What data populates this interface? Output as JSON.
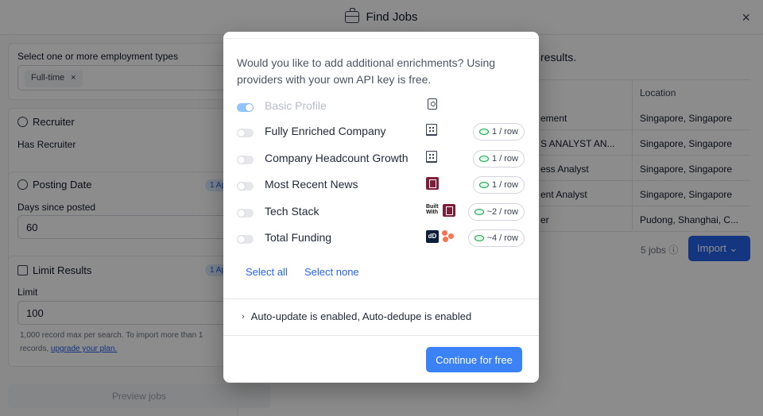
{
  "window": {
    "title": "Find Jobs",
    "close_icon": "×"
  },
  "left_panel": {
    "employment_label": "Select one or more employment types",
    "employment_chip": "Full-time",
    "chip_remove": "×",
    "recruiter_title": "Recruiter",
    "recruiter_option": "Has Recruiter",
    "posting_title": "Posting Date",
    "posting_badge": "1 Ap",
    "days_label": "Days since posted",
    "days_value": "60",
    "limit_title": "Limit Results",
    "limit_badge": "1 Ap",
    "limit_label": "Limit",
    "limit_value": "100",
    "help_text": "1,000 record max per search. To import more than 1",
    "help_text_2": "records, ",
    "upgrade_link": "upgrade your plan.",
    "preview_label": "Preview jobs"
  },
  "results": {
    "heading": "results.",
    "location_header": "Location",
    "rows": [
      {
        "title": "ement",
        "location": "Singapore, Singapore"
      },
      {
        "title": "S ANALYST AN...",
        "location": "Singapore, Singapore"
      },
      {
        "title": "ess Analyst",
        "location": "Singapore, Singapore"
      },
      {
        "title": "ent Analyst",
        "location": "Singapore, Singapore"
      },
      {
        "title": "er",
        "location": "Pudong, Shanghai, C..."
      }
    ],
    "jobs_count": "5 jobs ⓘ",
    "import_label": "Import ⌄"
  },
  "modal": {
    "question": "Would you like to add additional enrichments? Using providers with your own API key is free.",
    "enrichments": [
      {
        "label": "Basic Profile",
        "enabled": true,
        "disabled": true,
        "cost": ""
      },
      {
        "label": "Fully Enriched Company",
        "enabled": false,
        "cost": "1 / row"
      },
      {
        "label": "Company Headcount Growth",
        "enabled": false,
        "cost": "1 / row"
      },
      {
        "label": "Most Recent News",
        "enabled": false,
        "cost": "1 / row"
      },
      {
        "label": "Tech Stack",
        "enabled": false,
        "cost": "~2 / row"
      },
      {
        "label": "Total Funding",
        "enabled": false,
        "cost": "~4 / row"
      }
    ],
    "providers": {
      "builtwith_logo": "Built With",
      "dealroom_logo": "dD"
    },
    "select_all": "Select all",
    "select_none": "Select none",
    "auto_text": "Auto-update is enabled, Auto-dedupe is enabled",
    "chevron": "›",
    "continue_label": "Continue for free"
  },
  "colors": {
    "accent": "#3b82f6",
    "overlay": "rgba(0,0,0,0.45)"
  }
}
